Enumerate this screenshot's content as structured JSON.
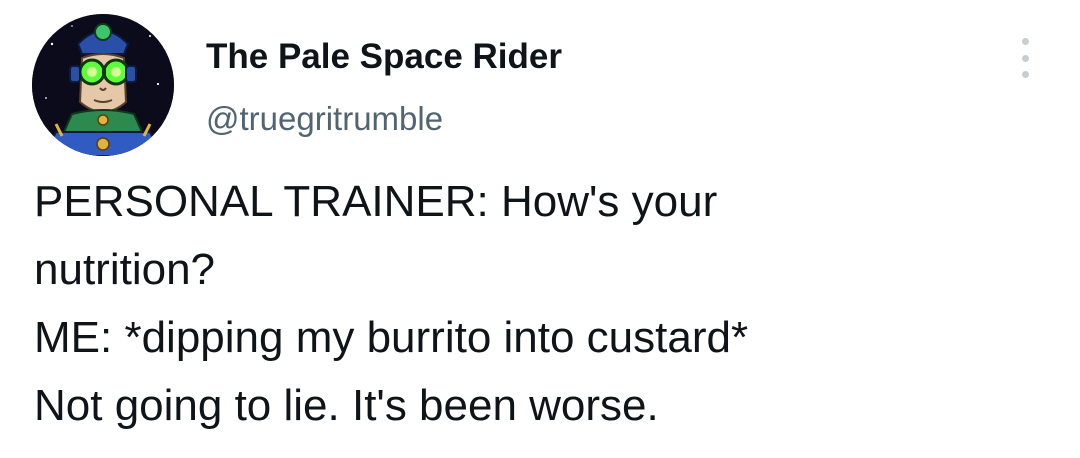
{
  "author": {
    "display_name": "The Pale Space Rider",
    "handle": "@truegritrumble",
    "avatar_icon": "alien-astronaut-avatar"
  },
  "menu": {
    "icon": "more-options-icon"
  },
  "tweet": {
    "lines": [
      "PERSONAL TRAINER: How's your",
      "nutrition?",
      "ME: *dipping my burrito into custard*",
      "Not going to lie. It's been worse."
    ]
  },
  "colors": {
    "text_primary": "#0f1419",
    "text_secondary": "#536471",
    "background": "#ffffff"
  }
}
